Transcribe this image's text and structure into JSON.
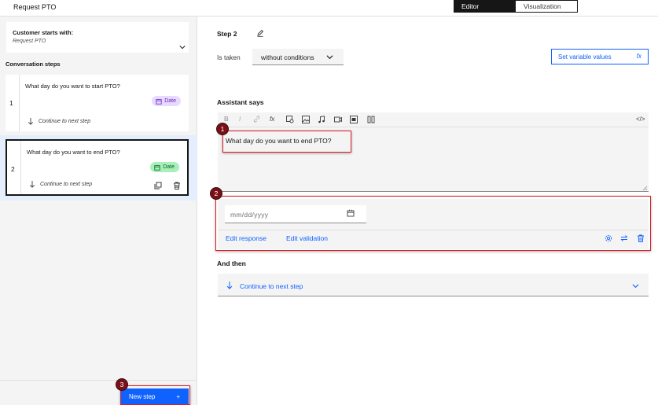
{
  "sidebar": {
    "title": "Request PTO",
    "starts_with_label": "Customer starts with:",
    "starts_with_value": "Request PTO",
    "steps_heading": "Conversation steps",
    "steps": [
      {
        "number": "1",
        "question": "What day do you want to start PTO?",
        "tag": "Date",
        "next": "Continue to next step"
      },
      {
        "number": "2",
        "question": "What day do you want to end PTO?",
        "tag": "Date",
        "next": "Continue to next step"
      }
    ],
    "new_step_label": "New step",
    "new_step_plus": "+"
  },
  "tabs": {
    "editor": "Editor",
    "visualization": "Visualization"
  },
  "editor": {
    "step_title": "Step 2",
    "is_taken_label": "Is taken",
    "condition_value": "without conditions",
    "set_variable_label": "Set variable values",
    "set_variable_icon": "fx",
    "assistant_says_label": "Assistant says",
    "toolbar": {
      "bold": "B",
      "italic": "I",
      "function": "fx",
      "code": "</>"
    },
    "message_text": "What day do you want to end PTO?",
    "date_placeholder": "mm/dd/yyyy",
    "edit_response_label": "Edit response",
    "edit_validation_label": "Edit validation",
    "and_then_label": "And then",
    "continue_label": "Continue to next step"
  },
  "annotations": {
    "a1": "1",
    "a2": "2",
    "a3": "3"
  },
  "colors": {
    "accent": "#0f62fe",
    "annotation": "#da1e28",
    "annotation_badge": "#7a1017"
  }
}
